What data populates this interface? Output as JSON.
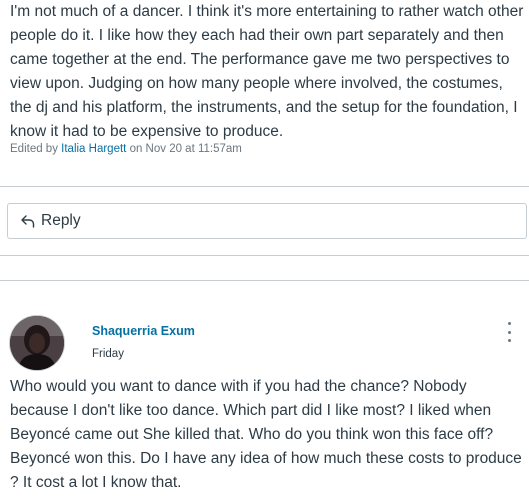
{
  "post": {
    "body": "I'm not much of a dancer. I think it's more entertaining to rather watch other people do it. I like how they each had their own part separately and then came together at the end. The performance gave me two perspectives to view upon. Judging on how many people where involved, the costumes, the dj and his platform, the instruments, and the setup for the foundation, I know it had to be expensive to produce.",
    "edited_prefix": "Edited by",
    "editor": "Italia Hargett",
    "edited_suffix": "on Nov 20 at 11:57am"
  },
  "reply_button": {
    "label": "Reply",
    "icon": "reply-arrow-icon"
  },
  "reply": {
    "author": "Shaquerria Exum",
    "date": "Friday",
    "body": "Who would you want to dance with if you had the chance? Nobody because I don't like too dance. Which part did I like most? I liked when Beyoncé came out She killed that. Who do you think won this face off? Beyoncé won this. Do I have any idea of how much these costs to produce ? It cost a lot I know that.",
    "menu_icon": "kebab-menu-icon"
  },
  "colors": {
    "link": "#0770a3",
    "text": "#2d3b45",
    "muted": "#6b7780",
    "border": "#c7cdd1"
  }
}
